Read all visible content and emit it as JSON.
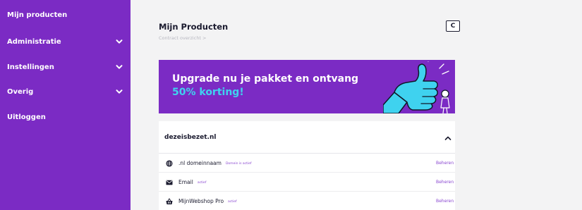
{
  "sidebar": {
    "items": [
      {
        "label": "Mijn producten",
        "expandable": false
      },
      {
        "label": "Administratie",
        "expandable": true
      },
      {
        "label": "Instellingen",
        "expandable": true
      },
      {
        "label": "Overig",
        "expandable": true
      },
      {
        "label": "Uitloggen",
        "expandable": false
      }
    ],
    "background": "#7b2bc4"
  },
  "header": {
    "title": "Mijn Producten",
    "breadcrumb": "Contract overzicht >",
    "corner_button": "C"
  },
  "banner": {
    "line1": "Upgrade nu je pakket en ontvang",
    "line2": "50% korting!",
    "colors": {
      "background": "#7b2bc4",
      "highlight": "#3fd2ef"
    },
    "illustration": "thumbs-up-icon"
  },
  "domain_card": {
    "domain": "dezeisbezet.nl",
    "rows": [
      {
        "icon": "globe-icon",
        "label": ".nl domeinnaam",
        "status": "Domein is actief",
        "action": "Beheren"
      },
      {
        "icon": "envelope-icon",
        "label": "Email",
        "status": "actief",
        "action": "Beheren"
      },
      {
        "icon": "shop-basket-icon",
        "label": "MijnWebshop Pro",
        "status": "actief",
        "action": "Beheren"
      }
    ]
  }
}
